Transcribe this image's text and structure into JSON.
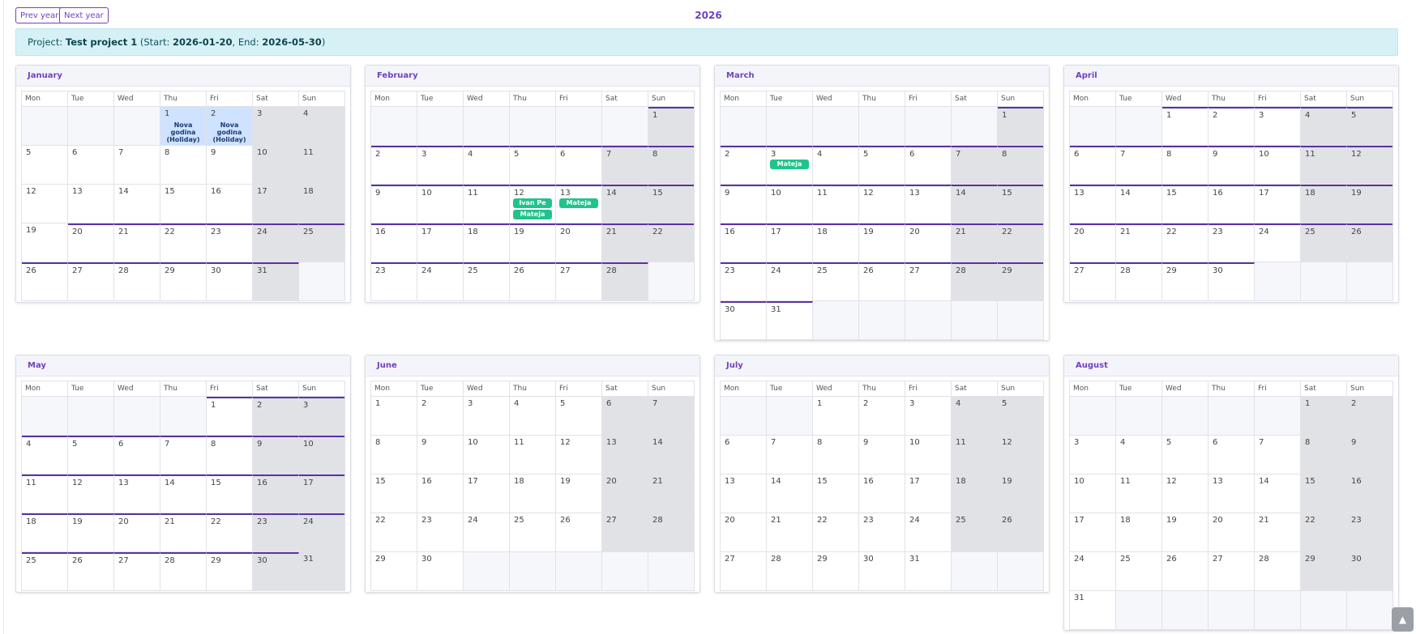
{
  "nav": {
    "prev_label": "Prev year",
    "next_label": "Next year",
    "year": "2026"
  },
  "project": {
    "prefix": "Project: ",
    "name": "Test project 1",
    "start_label": " (Start: ",
    "start": "2026-01-20",
    "end_label": ", End: ",
    "end": "2026-05-30",
    "suffix": ")"
  },
  "weekdays": [
    "Mon",
    "Tue",
    "Wed",
    "Thu",
    "Fri",
    "Sat",
    "Sun"
  ],
  "months": [
    {
      "name": "January",
      "year": 2026,
      "month": 1
    },
    {
      "name": "February",
      "year": 2026,
      "month": 2
    },
    {
      "name": "March",
      "year": 2026,
      "month": 3
    },
    {
      "name": "April",
      "year": 2026,
      "month": 4
    },
    {
      "name": "May",
      "year": 2026,
      "month": 5
    },
    {
      "name": "June",
      "year": 2026,
      "month": 6
    },
    {
      "name": "July",
      "year": 2026,
      "month": 7
    },
    {
      "name": "August",
      "year": 2026,
      "month": 8
    }
  ],
  "holidays": [
    {
      "date": "2026-01-01",
      "label": "Nova godina (Holiday)"
    },
    {
      "date": "2026-01-02",
      "label": "Nova godina (Holiday)"
    }
  ],
  "events": [
    {
      "date": "2026-02-12",
      "label": "Ivan Pe"
    },
    {
      "date": "2026-02-12",
      "label": "Mateja"
    },
    {
      "date": "2026-02-13",
      "label": "Mateja"
    },
    {
      "date": "2026-03-03",
      "label": "Mateja"
    }
  ],
  "more_markers": [
    {
      "date": "2026-02-12",
      "label": "..."
    }
  ],
  "scroll_top_icon": "chevron-up-icon"
}
